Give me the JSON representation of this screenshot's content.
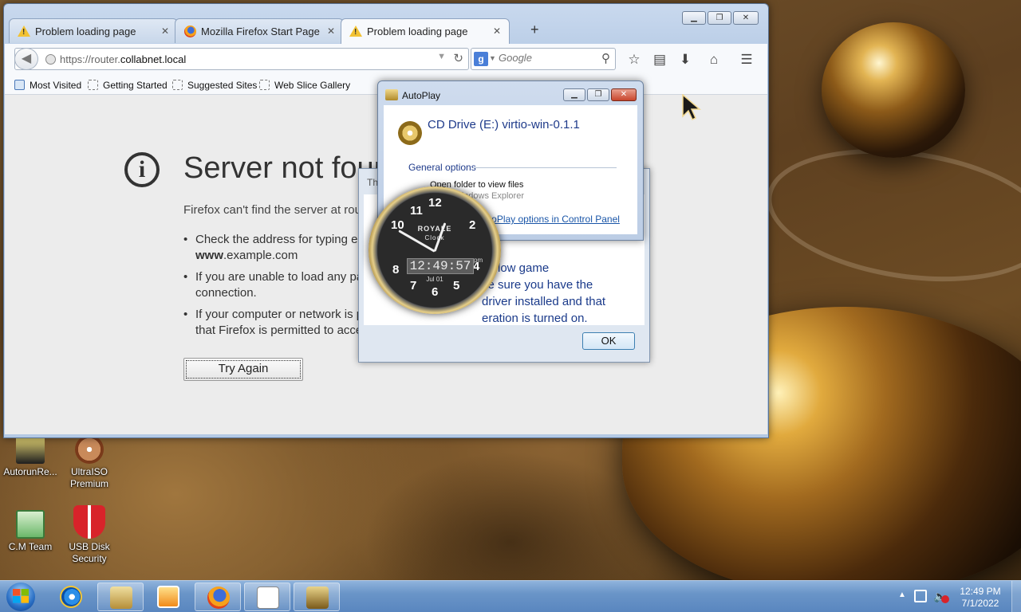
{
  "desktop": {
    "icons": [
      {
        "label": "AutorunRe..."
      },
      {
        "label": "UltraISO Premium"
      },
      {
        "label": "C.M Team"
      },
      {
        "label": "USB Disk Security"
      }
    ]
  },
  "firefox": {
    "tabs": [
      {
        "label": "Problem loading page",
        "icon": "warning-icon"
      },
      {
        "label": "Mozilla Firefox Start Page",
        "icon": "firefox-icon"
      },
      {
        "label": "Problem loading page",
        "icon": "warning-icon"
      }
    ],
    "url_prefix": "https://router.",
    "url_domain": "collabnet.local",
    "search_placeholder": "Google",
    "bookmarks": [
      "Most Visited",
      "Getting Started",
      "Suggested Sites",
      "Web Slice Gallery"
    ],
    "error": {
      "title": "Server not found",
      "description": "Firefox can't find the server at router.collabnet.local.",
      "bullets": [
        {
          "line1_pre": "Check the address for typing errors such as ",
          "line2_bold": "www",
          "line2_rest": ".example.com"
        },
        {
          "line1": "If you are unable to load any pages, check your computer's network",
          "line2": "connection."
        },
        {
          "line1": "If your computer or network is protected by a firewall or proxy, make sure",
          "line2": "that Firefox is permitted to access the Web."
        }
      ],
      "try_again": "Try Again"
    }
  },
  "back_dialog": {
    "title": "Th",
    "text": "d slow game\nke sure you have the\n driver installed and that\neration is turned on.",
    "ok": "OK"
  },
  "autoplay": {
    "title": "AutoPlay",
    "drive": "CD Drive (E:) virtio-win-0.1.1",
    "section": "General options",
    "option": "Open folder to view files",
    "option_sub": "using Windows Explorer",
    "link": "View more AutoPlay options in Control Panel"
  },
  "clock_gadget": {
    "brand": "ROYALE",
    "sub": "Clock",
    "digital": "12:49:57",
    "ampm": "pm",
    "date": "Jul 01"
  },
  "taskbar": {
    "time": "12:49 PM",
    "date": "7/1/2022"
  }
}
